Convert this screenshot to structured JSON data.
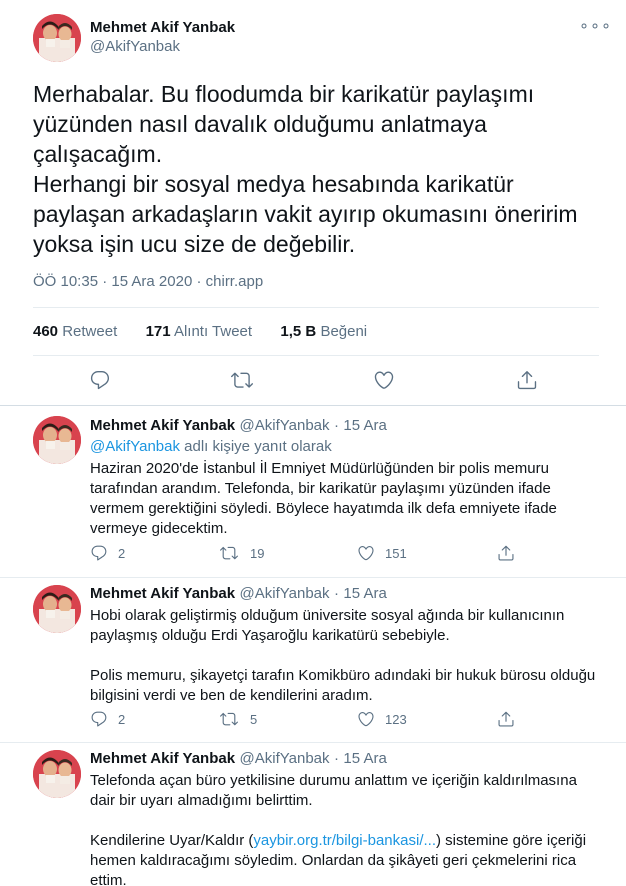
{
  "main_tweet": {
    "author_name": "Mehmet Akif Yanbak",
    "author_handle": "@AkifYanbak",
    "more_label": "∘∘∘",
    "text_lines": [
      "Merhabalar. Bu floodumda bir karikatür paylaşımı",
      "yüzünden nasıl davalık olduğumu anlatmaya",
      "çalışacağım.",
      "Herhangi bir sosyal medya hesabında karikatür",
      "paylaşan arkadaşların vakit ayırıp okumasını öneririm",
      "yoksa işin ucu size de değebilir."
    ],
    "time": "ÖÖ 10:35",
    "separator": "·",
    "date": "15 Ara 2020",
    "source": "chirr.app",
    "retweets_count": "460",
    "retweets_label": "Retweet",
    "quotes_count": "171",
    "quotes_label": "Alıntı Tweet",
    "likes_count": "1,5 B",
    "likes_label": "Beğeni"
  },
  "replies": [
    {
      "author_name": "Mehmet Akif Yanbak",
      "author_handle": "@AkifYanbak",
      "separator": "·",
      "date": "15 Ara",
      "reply_prefix_handle": "@AkifYanbak",
      "reply_prefix_text": " adlı kişiye yanıt olarak",
      "lines": [
        "Haziran 2020'de İstanbul İl Emniyet Müdürlüğünden bir polis memuru",
        "tarafından arandım. Telefonda, bir karikatür paylaşımı yüzünden ifade",
        "vermem gerektiğini söyledi. Böylece hayatımda ilk defa emniyete ifade",
        "vermeye gidecektim."
      ],
      "replies_count": "2",
      "retweets_count": "19",
      "likes_count": "151"
    },
    {
      "author_name": "Mehmet Akif Yanbak",
      "author_handle": "@AkifYanbak",
      "separator": "·",
      "date": "15 Ara",
      "lines": [
        "Hobi olarak geliştirmiş olduğum üniversite sosyal ağında bir kullanıcının",
        "paylaşmış olduğu Erdi Yaşaroğlu karikatürü sebebiyle.",
        "",
        "Polis memuru, şikayetçi tarafın Komikbüro adındaki bir hukuk bürosu olduğu",
        "bilgisini verdi ve ben de kendilerini aradım."
      ],
      "replies_count": "2",
      "retweets_count": "5",
      "likes_count": "123"
    },
    {
      "author_name": "Mehmet Akif Yanbak",
      "author_handle": "@AkifYanbak",
      "separator": "·",
      "date": "15 Ara",
      "lines": [
        "Telefonda açan büro yetkilisine durumu anlattım ve içeriğin kaldırılmasına",
        "dair bir uyarı almadığımı belirttim."
      ],
      "line3_pre": "Kendilerine Uyar/Kaldır (",
      "line3_link": "yaybir.org.tr/bilgi-bankasi/...",
      "line3_post": ") sistemine göre içeriği",
      "line4": "hemen kaldıracağımı söyledim. Onlardan da şikâyeti geri çekmelerini rica",
      "line5": "ettim."
    }
  ],
  "colors": {
    "accent": "#1b95e0",
    "secondary_text": "#5b7083",
    "divider": "#e6ecf0"
  },
  "icons": [
    "reply-icon",
    "retweet-icon",
    "like-icon",
    "share-icon",
    "more-icon"
  ]
}
